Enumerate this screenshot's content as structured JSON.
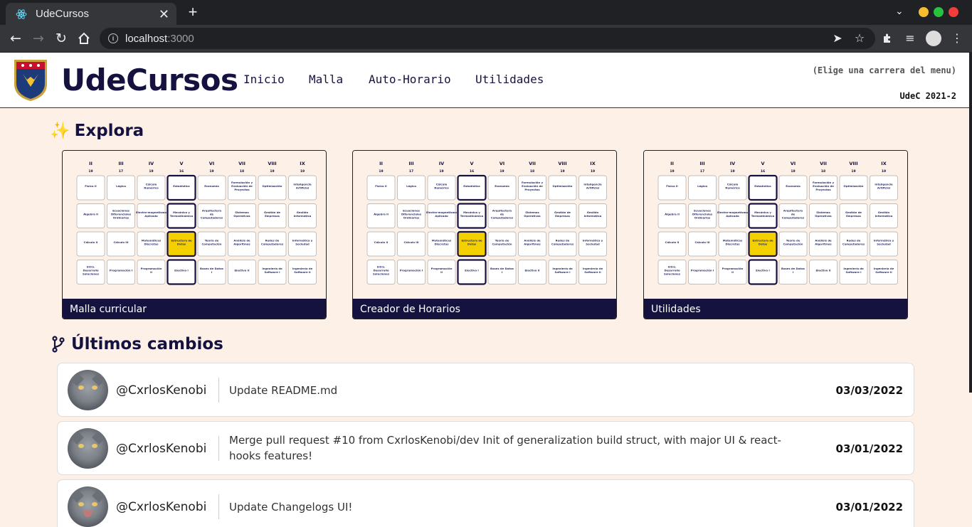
{
  "browser": {
    "tab_title": "UdeCursos",
    "url_host": "localhost",
    "url_port": ":3000"
  },
  "header": {
    "brand": "UdeCursos",
    "nav": [
      "Inicio",
      "Malla",
      "Auto-Horario",
      "Utilidades"
    ],
    "career_hint": "(Elige una carrera del menu)",
    "term": "UdeC 2021-2"
  },
  "explore": {
    "icon": "✨",
    "title": "Explora",
    "cards": [
      {
        "caption": "Malla curricular"
      },
      {
        "caption": "Creador de Horarios"
      },
      {
        "caption": "Utilidades"
      }
    ],
    "thumb": {
      "semesters": [
        {
          "roman": "II",
          "credits": "19"
        },
        {
          "roman": "III",
          "credits": "17"
        },
        {
          "roman": "IV",
          "credits": "19"
        },
        {
          "roman": "V",
          "credits": "16"
        },
        {
          "roman": "VI",
          "credits": "19"
        },
        {
          "roman": "VII",
          "credits": "18"
        },
        {
          "roman": "VIII",
          "credits": "19"
        },
        {
          "roman": "IX",
          "credits": "19"
        }
      ],
      "rows": [
        [
          "Física II",
          "Lógica",
          "Cálculo Numérico",
          "Estadística",
          "Economía",
          "Formulación y Evaluación de Proyectos",
          "Optimización",
          "Inteligencia Artificial"
        ],
        [
          "Álgebra II",
          "Ecuaciones Diferenciales Ordinarias",
          "Electro-magnetismo Aplicado",
          "Mecánica y Termodinámica",
          "Arquitectura de Computadores",
          "Sistemas Operativos",
          "Gestión de Empresas",
          "Gestión Informática"
        ],
        [
          "Cálculo II",
          "Cálculo III",
          "Matemáticas Discretas",
          "Estructura de Datos",
          "Teoría de Computación",
          "Análisis de Algoritmos",
          "Redes de Computadores",
          "Informática y Sociedad"
        ],
        [
          "Intro. Desarrollo Soluciones Inf.",
          "Programación I",
          "Programación II",
          "Electivo I",
          "Bases de Datos I",
          "Electivo II",
          "Ingeniería de Software I",
          "Ingeniería de Software II"
        ]
      ]
    }
  },
  "changes": {
    "title": "Últimos cambios",
    "commits": [
      {
        "user": "@CxrlosKenobi",
        "message": "Update README.md",
        "date": "03/03/2022"
      },
      {
        "user": "@CxrlosKenobi",
        "message": "Merge pull request #10 from CxrlosKenobi/dev Init of generalization build struct, with major UI & react-hooks features!",
        "date": "03/01/2022"
      },
      {
        "user": "@CxrlosKenobi",
        "message": "Update Changelogs UI!",
        "date": "03/01/2022"
      }
    ]
  }
}
